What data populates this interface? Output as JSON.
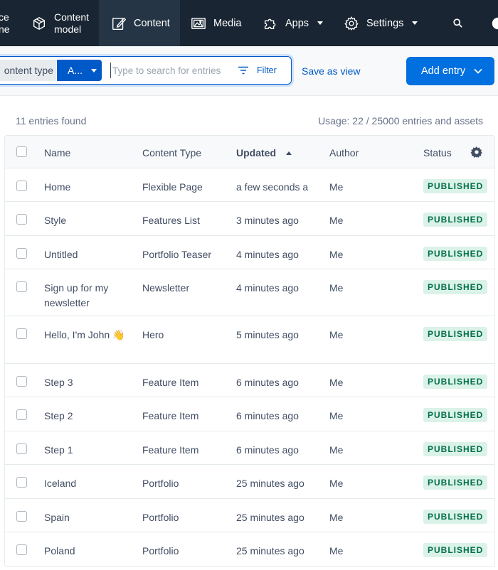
{
  "nav": {
    "partial_label_line1": "ce",
    "partial_label_line2": "ne",
    "items": [
      {
        "label_line1": "Content",
        "label_line2": "model",
        "icon": "cube-icon"
      },
      {
        "label": "Content",
        "icon": "edit-icon",
        "active": true
      },
      {
        "label": "Media",
        "icon": "image-icon"
      },
      {
        "label": "Apps",
        "icon": "puzzle-icon"
      },
      {
        "label": "Settings",
        "icon": "gear-icon"
      }
    ],
    "search_icon": "search-icon",
    "help_icon": "help-icon"
  },
  "toolbar": {
    "content_type_label": "ontent type",
    "content_type_value": "A...",
    "search_placeholder": "Type to search for entries",
    "filter_label": "Filter",
    "save_view_label": "Save as view",
    "add_entry_label": "Add entry"
  },
  "summary": {
    "entries_found": "11 entries found",
    "usage": "Usage: 22 / 25000 entries and assets"
  },
  "table": {
    "columns": {
      "name": "Name",
      "content_type": "Content Type",
      "updated": "Updated",
      "author": "Author",
      "status": "Status"
    },
    "sort": {
      "column": "updated",
      "direction": "ascending"
    },
    "rows": [
      {
        "name": "Home",
        "content_type": "Flexible Page",
        "updated": "a few seconds ago",
        "author": "Me",
        "status": "PUBLISHED"
      },
      {
        "name": "Style",
        "content_type": "Features List",
        "updated": "3 minutes ago",
        "author": "Me",
        "status": "PUBLISHED"
      },
      {
        "name": "Untitled",
        "content_type": "Portfolio Teaser",
        "updated": "4 minutes ago",
        "author": "Me",
        "status": "PUBLISHED"
      },
      {
        "name": "Sign up for my newsletter",
        "content_type": "Newsletter",
        "updated": "4 minutes ago",
        "author": "Me",
        "status": "PUBLISHED"
      },
      {
        "name": "Hello, I'm John 👋",
        "content_type": "Hero",
        "updated": "5 minutes ago",
        "author": "Me",
        "status": "PUBLISHED"
      },
      {
        "name": "Step 3",
        "content_type": "Feature Item",
        "updated": "6 minutes ago",
        "author": "Me",
        "status": "PUBLISHED"
      },
      {
        "name": "Step 2",
        "content_type": "Feature Item",
        "updated": "6 minutes ago",
        "author": "Me",
        "status": "PUBLISHED"
      },
      {
        "name": "Step 1",
        "content_type": "Feature Item",
        "updated": "6 minutes ago",
        "author": "Me",
        "status": "PUBLISHED"
      },
      {
        "name": "Iceland",
        "content_type": "Portfolio",
        "updated": "25 minutes ago",
        "author": "Me",
        "status": "PUBLISHED"
      },
      {
        "name": "Spain",
        "content_type": "Portfolio",
        "updated": "25 minutes ago",
        "author": "Me",
        "status": "PUBLISHED"
      },
      {
        "name": "Poland",
        "content_type": "Portfolio",
        "updated": "25 minutes ago",
        "author": "Me",
        "status": "PUBLISHED"
      }
    ]
  },
  "colors": {
    "nav_bg": "#192532",
    "primary": "#0059c8",
    "add_button": "#0070e0",
    "published_bg": "#dbf2e8",
    "published_text": "#006f4b"
  }
}
